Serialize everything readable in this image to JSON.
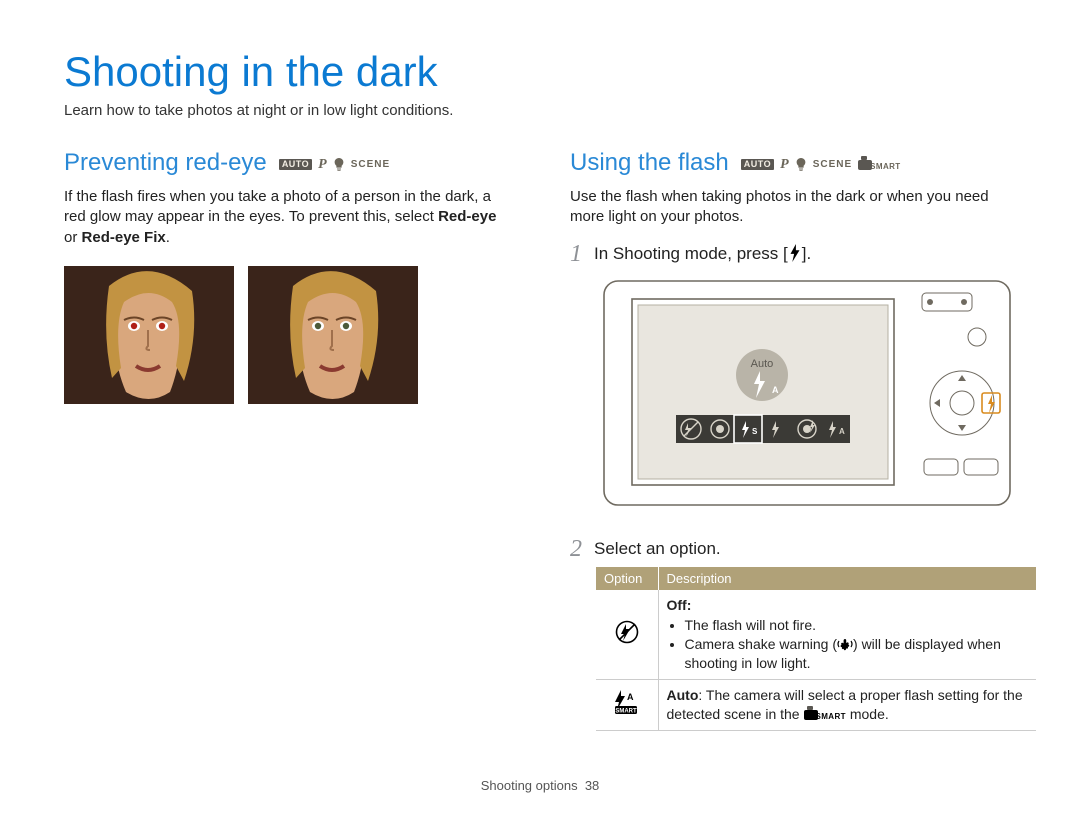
{
  "title": "Shooting in the dark",
  "intro": "Learn how to take photos at night or in low light conditions.",
  "badges": {
    "auto": "AUTO",
    "p": "P",
    "scene": "SCENE",
    "smart": "SMART"
  },
  "left": {
    "heading": "Preventing red-eye",
    "text_1": "If the flash fires when you take a photo of a person in the dark, a red glow may appear in the eyes. To prevent this, select ",
    "bold_1": "Red-eye",
    "text_2": " or ",
    "bold_2": "Red-eye Fix",
    "text_3": "."
  },
  "right": {
    "heading": "Using the flash",
    "text": "Use the flash when taking photos in the dark or when you need more light on your photos.",
    "step1_num": "1",
    "step1_pre": "In Shooting mode, press [",
    "step1_post": "].",
    "overlay_label": "Auto",
    "step2_num": "2",
    "step2": "Select an option.",
    "table": {
      "h1": "Option",
      "h2": "Description",
      "off": {
        "title": "Off:",
        "b1": "The flash will not fire.",
        "b2_pre": "Camera shake warning (",
        "b2_post": ") will be displayed when shooting in low light."
      },
      "auto": {
        "bold": "Auto",
        "text_pre": ": The camera will select a proper flash setting for the detected scene in the ",
        "text_post": " mode."
      }
    }
  },
  "footer_label": "Shooting options",
  "footer_page": "38"
}
